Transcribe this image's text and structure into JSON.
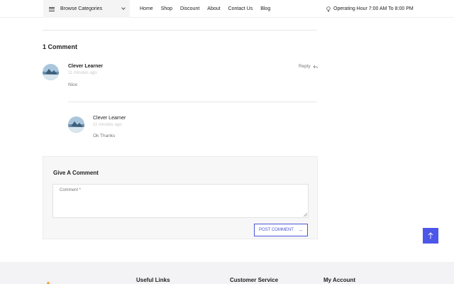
{
  "header": {
    "browse_label": "Browse Categories",
    "nav": [
      "Home",
      "Shop",
      "Discount",
      "About",
      "Contact Us",
      "Blog"
    ],
    "operating_hours": "Operating Hour 7:00 AM To 8:00 PM"
  },
  "comments": {
    "title": "1 Comment",
    "reply_label": "Reply",
    "main": {
      "name": "Clever Learner",
      "time": "11 minutes ago",
      "text": "Nice"
    },
    "reply": {
      "name": "Clever Learner",
      "time": "11 minutes ago",
      "text": "Ok Thanks"
    }
  },
  "form": {
    "title": "Give A Comment",
    "placeholder": "Comment *",
    "submit_label": "POST COMMENT",
    "submit_arrow": "→"
  },
  "footer": {
    "columns": [
      "Useful Links",
      "Customer Service",
      "My Account"
    ]
  },
  "colors": {
    "accent": "#4c56e8",
    "footer_bg": "#f3f3f5"
  },
  "icons": [
    "menu-icon",
    "chevron-down-icon",
    "bulb-icon",
    "reply-icon",
    "arrow-up-icon",
    "arrow-right-icon"
  ]
}
